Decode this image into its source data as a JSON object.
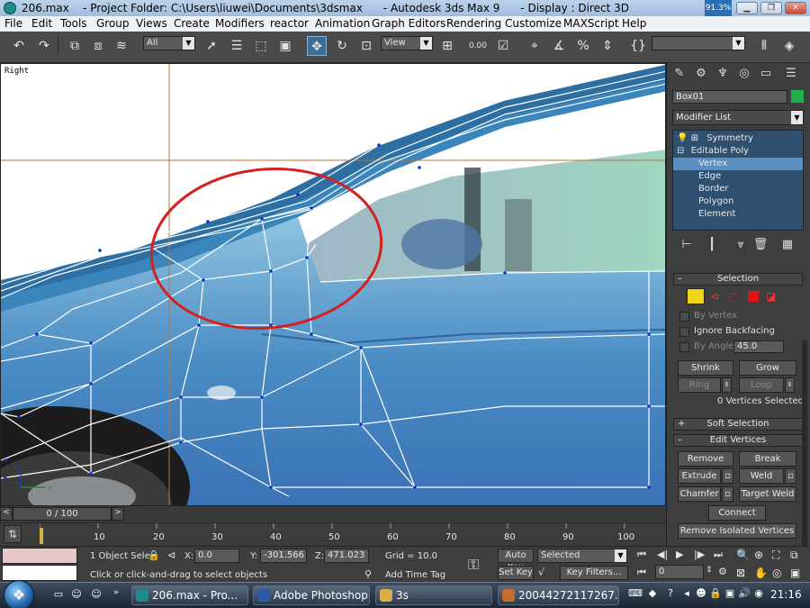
{
  "window": {
    "title": "206.max    - Project Folder: C:\\Users\\liuwei\\Documents\\3dsmax      - Autodesk 3ds Max 9      - Display : Direct 3D",
    "display_pct": "91.3%"
  },
  "menu": [
    "File",
    "Edit",
    "Tools",
    "Group",
    "Views",
    "Create",
    "Modifiers",
    "reactor",
    "Animation",
    "Graph Editors",
    "Rendering",
    "Customize",
    "MAXScript",
    "Help"
  ],
  "toolbar": {
    "selection_filter": "All",
    "reference_coord": "View",
    "snap_value": "0.00",
    "named_selection": ""
  },
  "viewport": {
    "label": "Right",
    "axis_y": "y",
    "axis_z": "z"
  },
  "panel": {
    "object_name": "Box01",
    "object_color": "#1db34a",
    "modifier_list": "Modifier List",
    "stack": [
      {
        "label": "Symmetry",
        "indent": 0
      },
      {
        "label": "Editable Poly",
        "indent": 0
      },
      {
        "label": "Vertex",
        "indent": 1
      },
      {
        "label": "Edge",
        "indent": 1
      },
      {
        "label": "Border",
        "indent": 1
      },
      {
        "label": "Polygon",
        "indent": 1
      },
      {
        "label": "Element",
        "indent": 1
      }
    ],
    "selection": {
      "header": "Selection",
      "by_vertex": "By Vertex",
      "ignore_backfacing": "Ignore Backfacing",
      "by_angle": "By Angle:",
      "angle_value": "45.0",
      "shrink": "Shrink",
      "grow": "Grow",
      "ring": "Ring",
      "loop": "Loop",
      "status": "0 Vertices Selected"
    },
    "soft_selection": "Soft Selection",
    "edit_vertices": {
      "header": "Edit Vertices",
      "remove": "Remove",
      "break": "Break",
      "extrude": "Extrude",
      "weld": "Weld",
      "chamfer": "Chamfer",
      "target_weld": "Target Weld",
      "connect": "Connect",
      "remove_isolated": "Remove Isolated Vertices"
    }
  },
  "timeline": {
    "frame": "0 / 100",
    "ticks": [
      "10",
      "20",
      "30",
      "40",
      "50",
      "60",
      "70",
      "80",
      "90",
      "100"
    ]
  },
  "status": {
    "selection": "1 Object Sele",
    "x": "0.0",
    "y": "-301.566",
    "z": "471.023",
    "grid": "Grid = 10.0",
    "prompt": "Click or click-and-drag to select objects",
    "add_time_tag": "Add Time Tag",
    "auto_key": "Auto Key",
    "set_key": "Set Key",
    "key_mode": "Selected",
    "key_filters": "Key Filters...",
    "current_frame": "0"
  },
  "taskbar": {
    "tasks": [
      "206.max    - Pro...",
      "Adobe Photoshop",
      "3s",
      "20044272117267..."
    ],
    "clock": "21:16"
  }
}
